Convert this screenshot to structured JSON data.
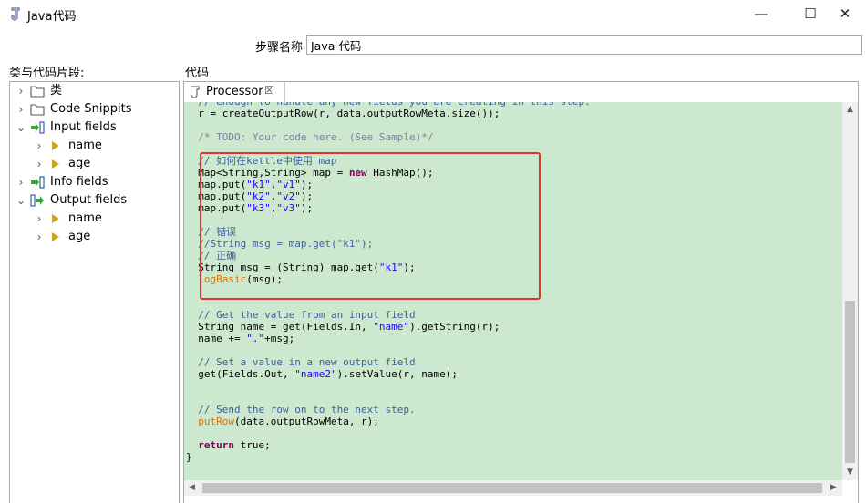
{
  "window": {
    "title": "Java代码",
    "minimize_glyph": "—",
    "maximize_glyph": "☐",
    "close_glyph": "✕"
  },
  "step": {
    "label": "步骤名称",
    "value": "Java 代码"
  },
  "tree": {
    "heading": "类与代码片段:",
    "items": [
      {
        "label": "类",
        "level": 0,
        "expanded": false,
        "icon": "folder-icon"
      },
      {
        "label": "Code Snippits",
        "level": 0,
        "expanded": false,
        "icon": "folder-icon"
      },
      {
        "label": "Input fields",
        "level": 0,
        "expanded": true,
        "icon": "input-fields-icon"
      },
      {
        "label": "name",
        "level": 1,
        "expanded": false,
        "icon": "field-arrow-icon"
      },
      {
        "label": "age",
        "level": 1,
        "expanded": false,
        "icon": "field-arrow-icon"
      },
      {
        "label": "Info fields",
        "level": 0,
        "expanded": false,
        "icon": "info-fields-icon"
      },
      {
        "label": "Output fields",
        "level": 0,
        "expanded": true,
        "icon": "output-fields-icon"
      },
      {
        "label": "name",
        "level": 1,
        "expanded": false,
        "icon": "field-arrow-icon"
      },
      {
        "label": "age",
        "level": 1,
        "expanded": false,
        "icon": "field-arrow-icon"
      }
    ]
  },
  "editor": {
    "heading": "代码",
    "tab_label": "Processor",
    "tab_close": "☒",
    "lines": [
      [
        [
          "com",
          "  // enough to handle any new fields you are creating in this step."
        ]
      ],
      [
        [
          "t",
          "  r = createOutputRow(r, data.outputRowMeta.size());"
        ]
      ],
      [
        [
          "t",
          ""
        ]
      ],
      [
        [
          "t",
          "  "
        ],
        [
          "tg",
          "/* TODO: Your code here. (See Sample)*/"
        ]
      ],
      [
        [
          "t",
          ""
        ]
      ],
      [
        [
          "com",
          "  // 如何在kettle中使用 map"
        ]
      ],
      [
        [
          "t",
          "  Map<String,String> map = "
        ],
        [
          "kw",
          "new"
        ],
        [
          "t",
          " HashMap();"
        ]
      ],
      [
        [
          "t",
          "  map.put("
        ],
        [
          "str",
          "\"k1\""
        ],
        [
          "t",
          ","
        ],
        [
          "str",
          "\"v1\""
        ],
        [
          "t",
          ");"
        ]
      ],
      [
        [
          "t",
          "  map.put("
        ],
        [
          "str",
          "\"k2\""
        ],
        [
          "t",
          ","
        ],
        [
          "str",
          "\"v2\""
        ],
        [
          "t",
          ");"
        ]
      ],
      [
        [
          "t",
          "  map.put("
        ],
        [
          "str",
          "\"k3\""
        ],
        [
          "t",
          ","
        ],
        [
          "str",
          "\"v3\""
        ],
        [
          "t",
          ");"
        ]
      ],
      [
        [
          "t",
          ""
        ]
      ],
      [
        [
          "com",
          "  // 错误"
        ]
      ],
      [
        [
          "com",
          "  //String msg = map.get(\"k1\");"
        ]
      ],
      [
        [
          "com",
          "  // 正确"
        ]
      ],
      [
        [
          "t",
          "  String msg = (String) map.get("
        ],
        [
          "str",
          "\"k1\""
        ],
        [
          "t",
          ");"
        ]
      ],
      [
        [
          "fn",
          "  logBasic"
        ],
        [
          "t",
          "(msg);"
        ]
      ],
      [
        [
          "t",
          ""
        ]
      ],
      [
        [
          "t",
          ""
        ]
      ],
      [
        [
          "com",
          "  // Get the value from an input field"
        ]
      ],
      [
        [
          "t",
          "  String name = get(Fields.In, "
        ],
        [
          "str",
          "\"name\""
        ],
        [
          "t",
          ").getString(r);"
        ]
      ],
      [
        [
          "t",
          "  name += "
        ],
        [
          "str",
          "\".\""
        ],
        [
          "t",
          "+msg;"
        ]
      ],
      [
        [
          "t",
          ""
        ]
      ],
      [
        [
          "com",
          "  // Set a value in a new output field"
        ]
      ],
      [
        [
          "t",
          "  get(Fields.Out, "
        ],
        [
          "str",
          "\"name2\""
        ],
        [
          "t",
          ").setValue(r, name);"
        ]
      ],
      [
        [
          "t",
          ""
        ]
      ],
      [
        [
          "t",
          ""
        ]
      ],
      [
        [
          "com",
          "  // Send the row on to the next step."
        ]
      ],
      [
        [
          "fn",
          "  putRow"
        ],
        [
          "t",
          "(data.outputRowMeta, r);"
        ]
      ],
      [
        [
          "t",
          ""
        ]
      ],
      [
        [
          "t",
          "  "
        ],
        [
          "kw",
          "return"
        ],
        [
          "t",
          " true;"
        ]
      ],
      [
        [
          "t",
          "}"
        ]
      ]
    ]
  },
  "colors": {
    "editor_bg": "#cce8cf",
    "comment": "#3f5f9f",
    "keyword": "#7f0055",
    "string": "#2a00ff",
    "method": "#e07000",
    "highlight_border": "#e8302a"
  }
}
